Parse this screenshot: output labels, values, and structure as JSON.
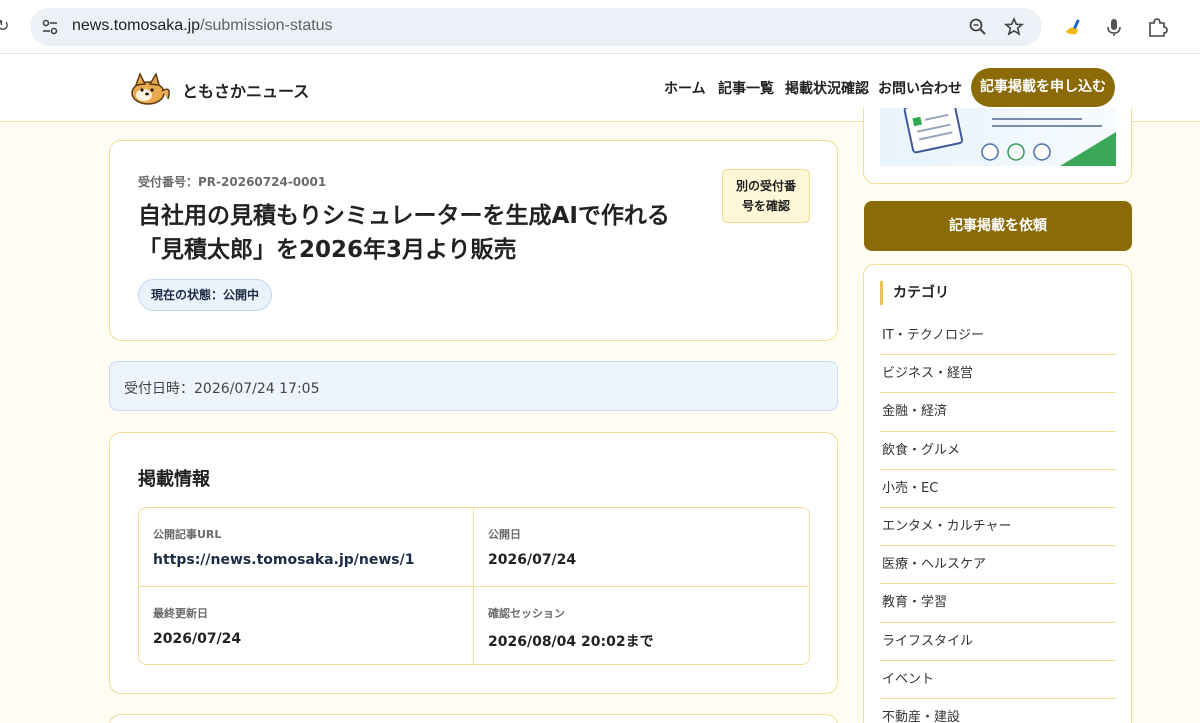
{
  "browser": {
    "url_domain": "news.tomosaka.jp",
    "url_path": "/submission-status"
  },
  "site": {
    "brand": "ともさかニュース",
    "nav": [
      "ホーム",
      "記事一覧",
      "掲載状況確認",
      "お問い合わせ"
    ],
    "cta": "記事掲載を申し込む"
  },
  "submission": {
    "receipt_no": "受付番号：PR-20260724-0001",
    "title_line1": "自社用の見積もりシミュレーターを生成AIで作れる",
    "title_line2": "「見積太郎」を2026年3月より販売",
    "status": "現在の状態：公開中",
    "alt_button_line1": "別の受付番",
    "alt_button_line2": "号を確認",
    "received_at": "受付日時：2026/07/24 17:05"
  },
  "publication": {
    "section_title": "掲載情報",
    "fields": [
      {
        "label": "公開記事URL",
        "value": "https://news.tomosaka.jp/news/1"
      },
      {
        "label": "公開日",
        "value": "2026/07/24"
      },
      {
        "label": "最終更新日",
        "value": "2026/07/24"
      },
      {
        "label": "確認セッション",
        "value": "2026/08/04 20:02まで"
      }
    ]
  },
  "sidebar": {
    "cta": "記事掲載を依頼",
    "category_title": "カテゴリ",
    "categories": [
      "IT・テクノロジー",
      "ビジネス・経営",
      "金融・経済",
      "飲食・グルメ",
      "小売・EC",
      "エンタメ・カルチャー",
      "医療・ヘルスケア",
      "教育・学習",
      "ライフスタイル",
      "イベント",
      "不動産・建設"
    ]
  },
  "colors": {
    "accent": "#8a6b07",
    "border": "#f2dd99",
    "background": "#fffdf2"
  }
}
